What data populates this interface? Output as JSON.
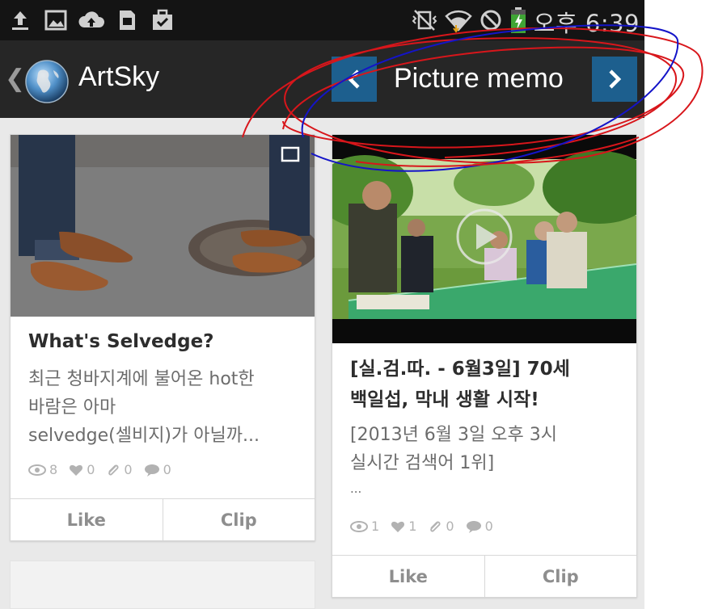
{
  "status_bar": {
    "left_icons": [
      "upload-icon",
      "image-icon",
      "cloud-upload-icon",
      "sd-card-icon",
      "briefcase-check-icon"
    ],
    "right_icons": [
      "vibrate-off-icon",
      "wifi-icon",
      "no-sign-icon",
      "battery-charging-icon"
    ],
    "time": "오후 6:39"
  },
  "action_bar": {
    "app_title": "ArtSky",
    "page_title": "Picture memo",
    "nav_prev": "‹",
    "nav_next": "›",
    "accent": "#1d5f8e"
  },
  "cards": [
    {
      "title": "What's Selvedge?",
      "desc_lines": [
        "최근 청바지계에 불어온 hot한",
        "바람은 아마",
        "selvedge(셀비지)가 아닐까..."
      ],
      "stats": {
        "views": "8",
        "likes": "0",
        "clips": "0",
        "comments": "0"
      },
      "like_label": "Like",
      "clip_label": "Clip"
    },
    {
      "title_lines": [
        "[실.검.따. - 6월3일] 70세",
        "백일섭, 막내 생활 시작!"
      ],
      "desc_lines": [
        "[2013년 6월 3일 오후 3시",
        "실시간 검색어 1위]",
        "..."
      ],
      "stats": {
        "views": "1",
        "likes": "1",
        "clips": "0",
        "comments": "0"
      },
      "like_label": "Like",
      "clip_label": "Clip"
    }
  ]
}
